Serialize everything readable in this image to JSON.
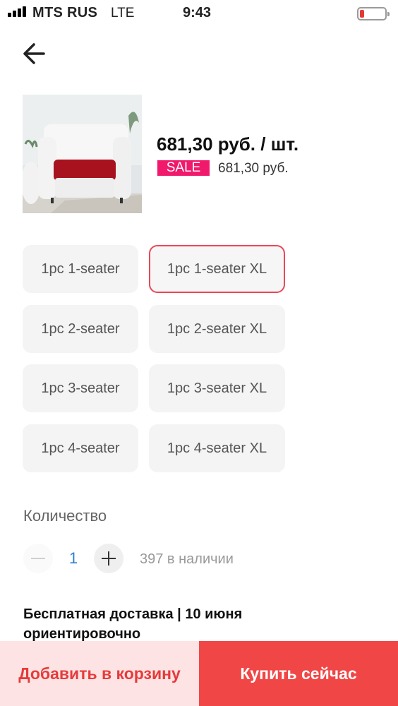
{
  "status_bar": {
    "carrier": "MTS RUS",
    "network": "LTE",
    "time": "9:43",
    "battery_color": "#e53935"
  },
  "nav": {
    "back_icon": "arrow-left-icon"
  },
  "product": {
    "price": "681,30 руб. / шт.",
    "sale_badge": "SALE",
    "old_price": "681,30 руб.",
    "sale_color": "#f0196b"
  },
  "variants": [
    {
      "label": "1pc 1-seater",
      "selected": false
    },
    {
      "label": "1pc 1-seater XL",
      "selected": true
    },
    {
      "label": "1pc 2-seater",
      "selected": false
    },
    {
      "label": "1pc 2-seater XL",
      "selected": false
    },
    {
      "label": "1pc 3-seater",
      "selected": false
    },
    {
      "label": "1pc 3-seater XL",
      "selected": false
    },
    {
      "label": "1pc 4-seater",
      "selected": false
    },
    {
      "label": "1pc 4-seater XL",
      "selected": false
    }
  ],
  "quantity": {
    "label": "Количество",
    "value": "1",
    "stock": "397 в наличии"
  },
  "delivery": {
    "text": "Бесплатная доставка | 10 июня ориентировочно"
  },
  "actions": {
    "add_to_cart": "Добавить в корзину",
    "buy_now": "Купить сейчас",
    "accent": "#f14646"
  }
}
